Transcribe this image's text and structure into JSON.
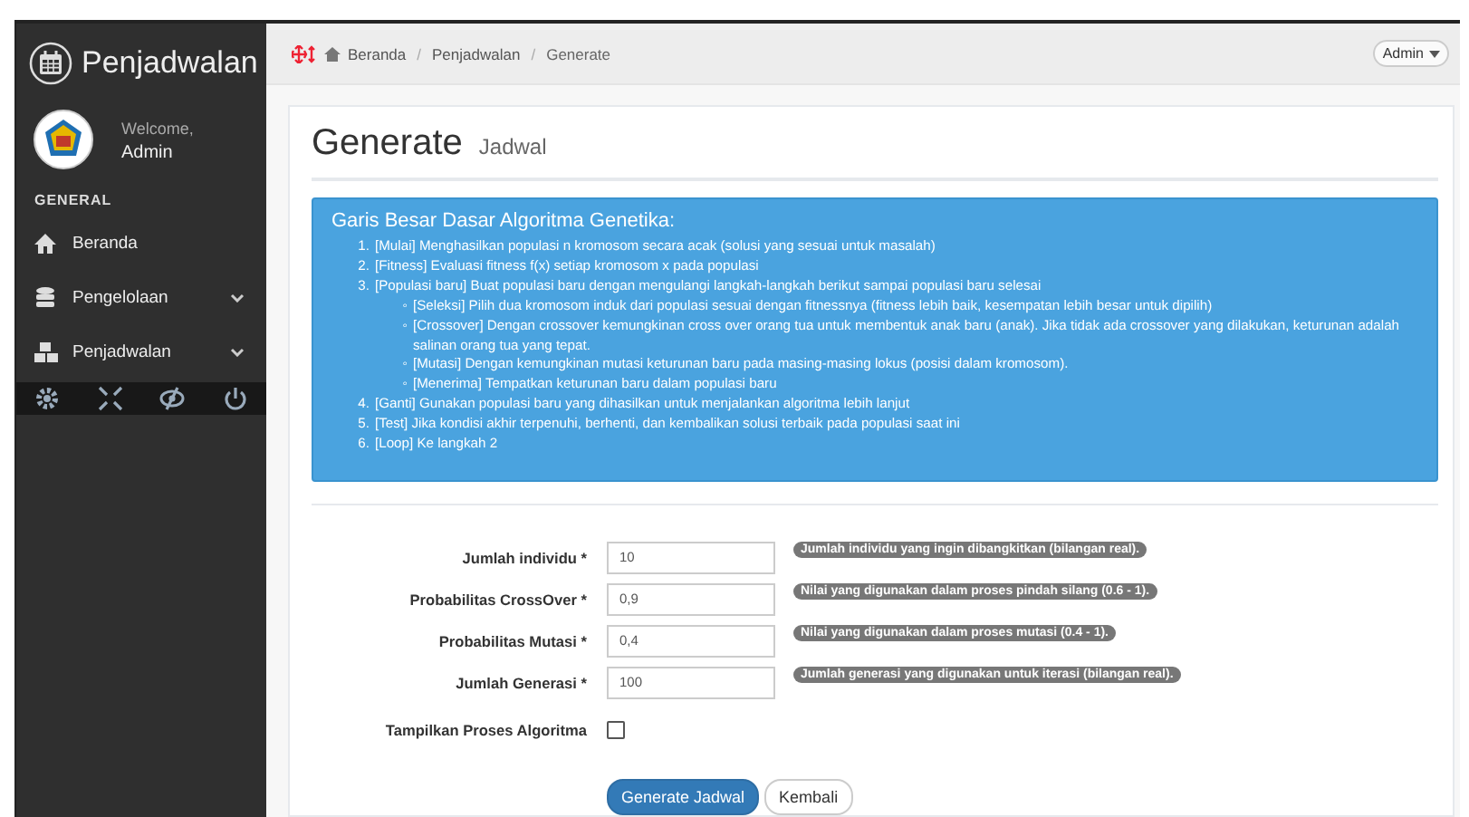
{
  "sidebar": {
    "title": "Penjadwalan",
    "welcome": "Welcome,",
    "user": "Admin",
    "section": "GENERAL",
    "items": [
      {
        "label": "Beranda",
        "expandable": false
      },
      {
        "label": "Pengelolaan",
        "expandable": true
      },
      {
        "label": "Penjadwalan",
        "expandable": true
      }
    ]
  },
  "topbar": {
    "breadcrumb": [
      "Beranda",
      "Penjadwalan",
      "Generate"
    ],
    "separator": "/",
    "user_menu": "Admin"
  },
  "page": {
    "title": "Generate",
    "subtitle": "Jadwal"
  },
  "info": {
    "heading": "Garis Besar Dasar Algoritma Genetika:",
    "steps": [
      {
        "marker": "1.",
        "text": "[Mulai] Menghasilkan populasi n kromosom secara acak (solusi yang sesuai untuk masalah)"
      },
      {
        "marker": "2.",
        "text": "[Fitness] Evaluasi fitness f(x) setiap kromosom x pada populasi"
      },
      {
        "marker": "3.",
        "text": "[Populasi baru] Buat populasi baru dengan mengulangi langkah-langkah berikut sampai populasi baru selesai",
        "children": [
          {
            "marker": "◦",
            "text": "[Seleksi] Pilih dua kromosom induk dari populasi sesuai dengan fitnessnya (fitness lebih baik, kesempatan lebih besar untuk dipilih)"
          },
          {
            "marker": "◦",
            "text": "[Crossover] Dengan crossover kemungkinan cross over orang tua untuk membentuk anak baru (anak). Jika tidak ada crossover yang dilakukan, keturunan adalah salinan orang tua yang tepat."
          },
          {
            "marker": "◦",
            "text": "[Mutasi] Dengan kemungkinan mutasi keturunan baru pada masing-masing lokus (posisi dalam kromosom)."
          },
          {
            "marker": "◦",
            "text": "[Menerima] Tempatkan keturunan baru dalam populasi baru"
          }
        ]
      },
      {
        "marker": "4.",
        "text": "[Ganti] Gunakan populasi baru yang dihasilkan untuk menjalankan algoritma lebih lanjut"
      },
      {
        "marker": "5.",
        "text": "[Test] Jika kondisi akhir terpenuhi, berhenti, dan kembalikan solusi terbaik pada populasi saat ini"
      },
      {
        "marker": "6.",
        "text": "[Loop] Ke langkah 2"
      }
    ]
  },
  "form": {
    "fields": [
      {
        "kind": "text",
        "label": "Jumlah individu *",
        "value": "10",
        "help": "Jumlah individu yang ingin dibangkitkan (bilangan real)."
      },
      {
        "kind": "text",
        "label": "Probabilitas CrossOver *",
        "value": "0,9",
        "help": "Nilai yang digunakan dalam proses pindah silang (0.6 - 1)."
      },
      {
        "kind": "text",
        "label": "Probabilitas Mutasi *",
        "value": "0,4",
        "help": "Nilai yang digunakan dalam proses mutasi (0.4 - 1)."
      },
      {
        "kind": "text",
        "label": "Jumlah Generasi *",
        "value": "100",
        "help": "Jumlah generasi yang digunakan untuk iterasi (bilangan real)."
      },
      {
        "kind": "checkbox",
        "label": "Tampilkan Proses Algoritma",
        "checked": false
      }
    ],
    "buttons": [
      {
        "label": "Generate Jadwal",
        "primary": true
      },
      {
        "label": "Kembali",
        "primary": false
      }
    ]
  }
}
